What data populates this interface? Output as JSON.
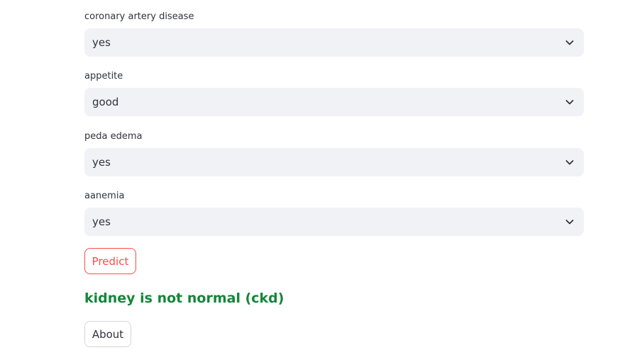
{
  "fields": [
    {
      "label": "coronary artery disease",
      "value": "yes"
    },
    {
      "label": "appetite",
      "value": "good"
    },
    {
      "label": "peda edema",
      "value": "yes"
    },
    {
      "label": "aanemia",
      "value": "yes"
    }
  ],
  "icons": {
    "dropdown": "chevron-down-icon"
  },
  "buttons": {
    "predict_label": "Predict",
    "about_label": "About"
  },
  "result": {
    "text": "kidney is not normal (ckd)",
    "color": "#14863a"
  },
  "colors": {
    "accent": "#ff4b4b",
    "select_bg": "#f0f2f6",
    "text": "#31333f"
  }
}
